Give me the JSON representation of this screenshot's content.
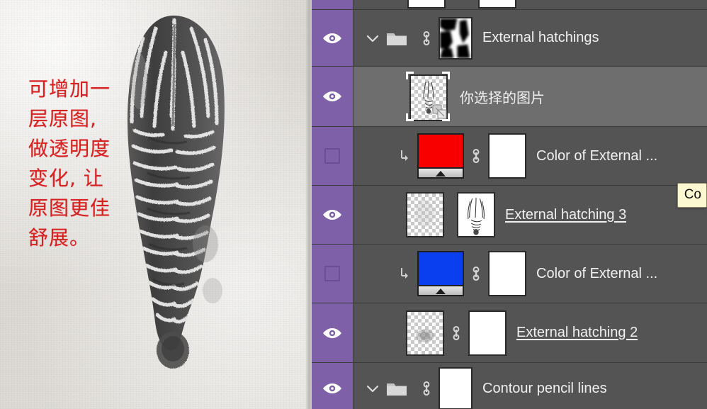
{
  "canvas": {
    "annotation_text": "可增加一\n层原图,\n做透明度\n变化, 让\n原图更佳\n舒展。",
    "annotation_color": "#d62121",
    "artwork_description": "pencil-charcoal-hatching-drawing",
    "paper_color": "#e0ddd8"
  },
  "panel": {
    "background_color": "#545454",
    "selected_row_color": "#6e6e6e",
    "visibility_column_color": "#7e60a8",
    "tooltip": {
      "text": "Co",
      "background": "#fbf7d0"
    },
    "rows": [
      {
        "name": "External hatchings",
        "type": "group",
        "visible": true,
        "visibility_icon": "eye-icon",
        "selected": false,
        "expanded": true,
        "chevron_icon": "chevron-down-icon",
        "folder_icon": "folder-icon",
        "link_icon": "link-icon",
        "mask_thumbnail": "black-white-blurred-mask",
        "underlined": false
      },
      {
        "name": "你选择的图片",
        "type": "smart-object",
        "visible": true,
        "visibility_icon": "eye-icon",
        "selected": true,
        "thumbnail": "transparent-checker-with-drawing",
        "badge_icon": "smart-object-badge-icon",
        "underlined": false
      },
      {
        "name": "Color of External ...",
        "type": "solid-color-adjustment",
        "visible": false,
        "visibility_icon": "empty-checkbox-icon",
        "selected": false,
        "clipped": true,
        "clip_icon": "clipping-mask-arrow-icon",
        "swatch_color": "#f90000",
        "link_icon": "link-icon",
        "mask_thumbnail": "white-mask",
        "underlined": false
      },
      {
        "name": "External hatching 3",
        "type": "layer",
        "visible": true,
        "visibility_icon": "eye-icon",
        "selected": false,
        "thumbnail": "transparent-checker",
        "mask_thumbnail": "white-mask-with-hatching",
        "underlined": true
      },
      {
        "name": "Color of External ...",
        "type": "solid-color-adjustment",
        "visible": false,
        "visibility_icon": "empty-checkbox-icon",
        "selected": false,
        "clipped": true,
        "clip_icon": "clipping-mask-arrow-icon",
        "swatch_color": "#0a3ff0",
        "link_icon": "link-icon",
        "mask_thumbnail": "white-mask",
        "underlined": false
      },
      {
        "name": "External hatching 2",
        "type": "layer",
        "visible": true,
        "visibility_icon": "eye-icon",
        "selected": false,
        "thumbnail": "transparent-checker-faint",
        "link_icon": "link-icon",
        "mask_thumbnail": "white-mask",
        "underlined": true
      },
      {
        "name": "Contour pencil lines",
        "type": "group",
        "visible": true,
        "visibility_icon": "eye-icon",
        "selected": false,
        "expanded": true,
        "chevron_icon": "chevron-down-icon",
        "folder_icon": "folder-icon",
        "link_icon": "link-icon",
        "mask_thumbnail": "white-mask",
        "underlined": false
      }
    ]
  }
}
